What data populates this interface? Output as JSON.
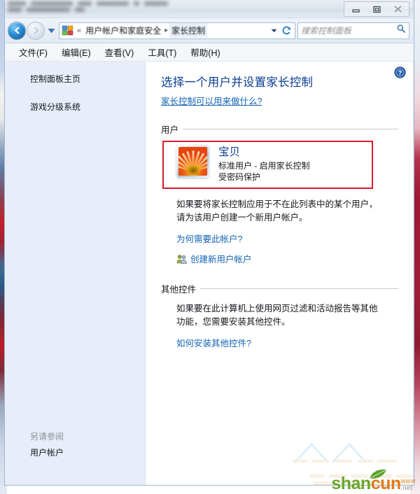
{
  "window": {
    "title_obscured": true,
    "controls": {
      "minimize": "最小化",
      "maximize": "最大化",
      "close": "关闭"
    }
  },
  "addressbar": {
    "back_tooltip": "后退",
    "forward_tooltip": "前进",
    "history_tooltip": "最近访问的位置",
    "control_panel_icon": "control-panel-icon",
    "breadcrumb_prefix": "«",
    "breadcrumbs": [
      "用户帐户和家庭安全",
      "家长控制"
    ],
    "breadcrumb_separator": "▸",
    "refresh_tooltip": "刷新",
    "search": {
      "placeholder": "搜索控制面板",
      "value": ""
    }
  },
  "menubar": {
    "items": [
      "文件(F)",
      "编辑(E)",
      "查看(V)",
      "工具(T)",
      "帮助(H)"
    ]
  },
  "sidebar": {
    "items": [
      "控制面板主页",
      "游戏分级系统"
    ],
    "see_also_heading": "另请参阅",
    "see_also_items": [
      "用户帐户"
    ]
  },
  "content": {
    "help_icon": "help-icon",
    "title": "选择一个用户并设置家长控制",
    "subtitle_link": "家长控制可以用来做什么?",
    "users_section": {
      "heading": "用户",
      "user": {
        "name": "宝贝",
        "account_type_line": "标准用户 - 启用家长控制",
        "password_line": "受密码保护",
        "avatar": "sunflower-avatar"
      },
      "highlighted": true,
      "highlight_color": "#d71c2b"
    },
    "add_user_paragraph": "如果要将家长控制应用于不在此列表中的某个用户，请为该用户创建一个新用户帐户。",
    "why_link": "为何需要此帐户?",
    "create_account_link": "创建新用户帐户",
    "other_section": {
      "heading": "其他控件",
      "paragraph": "如果要在此计算机上使用网页过滤和活动报告等其他功能，您需要安装其他控件。",
      "link": "如何安装其他控件?"
    }
  },
  "watermark": {
    "part1": "sh",
    "part2": "an",
    "part3": "cun",
    "www": "WWW",
    "domain": ".net"
  }
}
